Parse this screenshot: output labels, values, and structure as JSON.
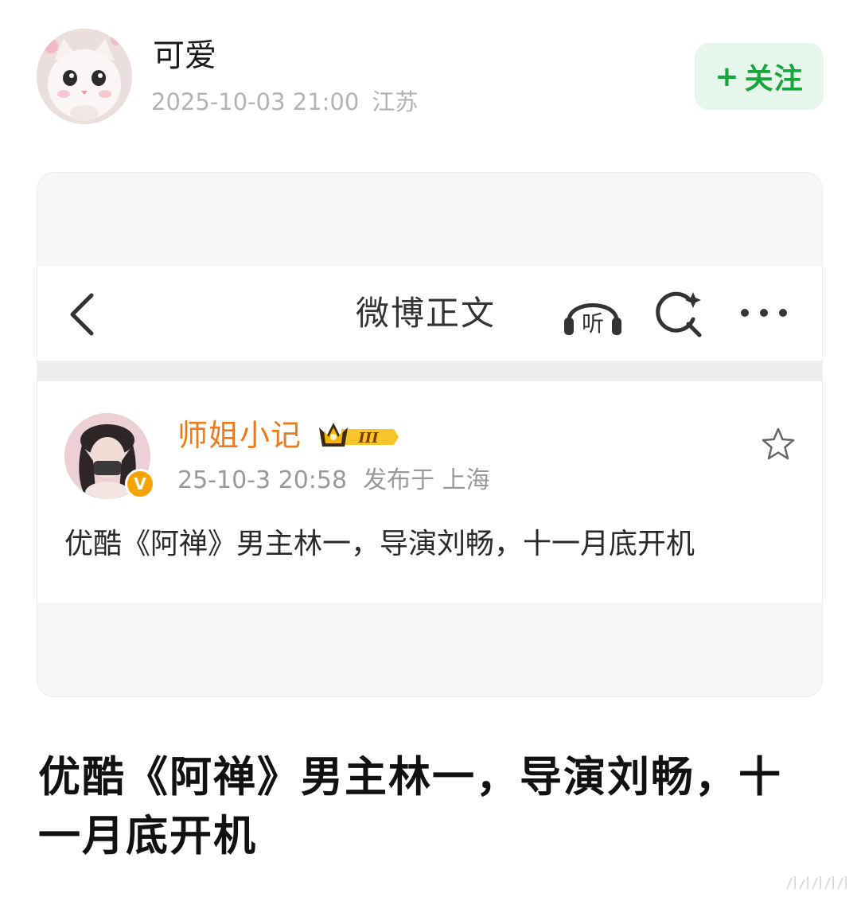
{
  "poster": {
    "name": "可爱",
    "timestamp": "2025-10-03 21:00",
    "location": "江苏",
    "follow_label": "关注",
    "follow_plus": "+",
    "follow_color": "#15a63c"
  },
  "screenshot": {
    "header_title": "微博正文",
    "listen_label": "听",
    "author_name": "师姐小记",
    "author_color": "#ef7a1a",
    "vip_level": "III",
    "verified_mark": "V",
    "post_time": "25-10-3 20:58",
    "post_location": "发布于 上海",
    "post_text": "优酷《阿禅》男主林一，导演刘畅，十一月底开机"
  },
  "caption": "优酷《阿禅》男主林一，导演刘畅，十一月底开机",
  "icons": [
    "back-icon",
    "listen-icon",
    "search-icon",
    "more-icon",
    "star-icon",
    "crown-icon",
    "verified-icon"
  ]
}
